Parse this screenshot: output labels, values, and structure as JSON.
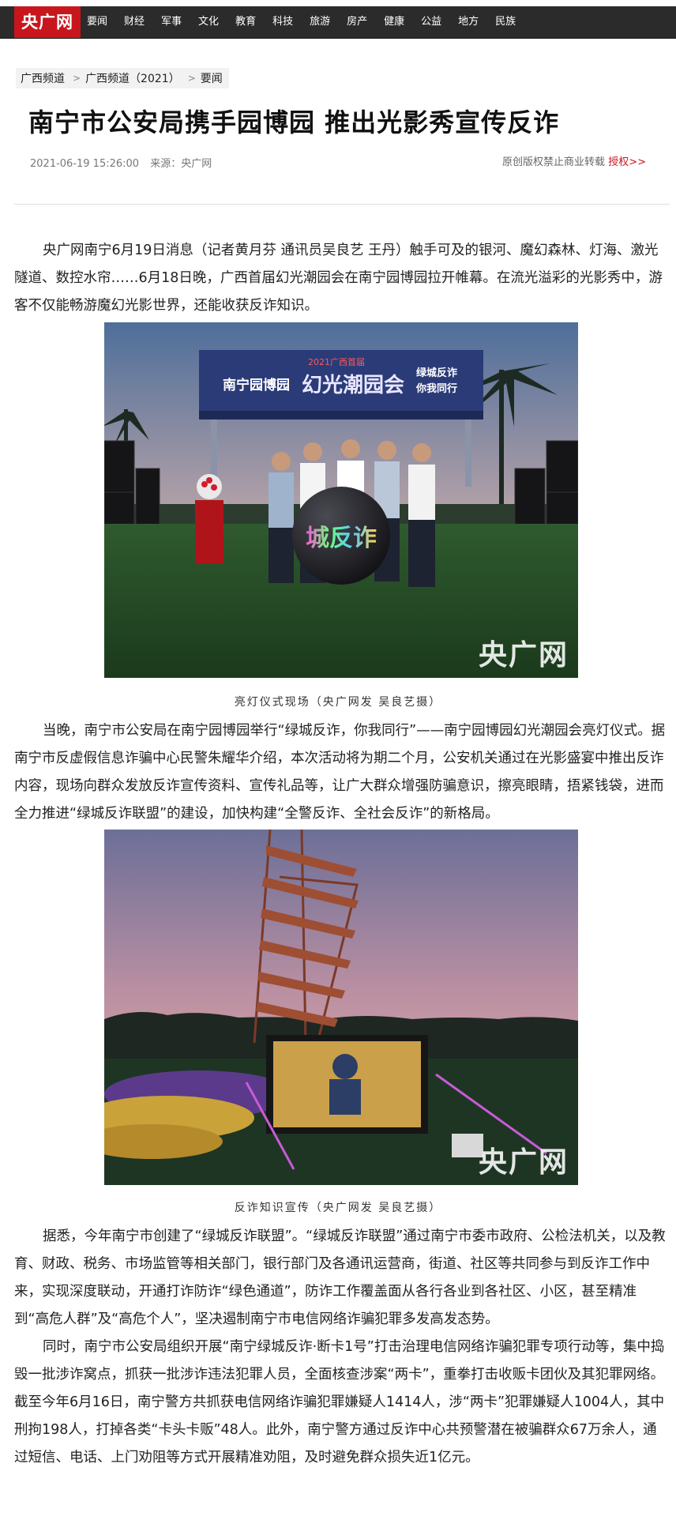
{
  "site": {
    "logo": "央广网",
    "nav": [
      "要闻",
      "财经",
      "军事",
      "文化",
      "教育",
      "科技",
      "旅游",
      "房产",
      "健康",
      "公益",
      "地方",
      "民族"
    ]
  },
  "breadcrumb": {
    "items": [
      "广西频道",
      "广西频道（2021）",
      "要闻"
    ],
    "separator": ">"
  },
  "article": {
    "title": "南宁市公安局携手园博园 推出光影秀宣传反诈",
    "date": "2021-06-19 15:26:00",
    "source": "来源：央广网",
    "copyright_text": "原创版权禁止商业转载",
    "copyright_link": "授权>>",
    "paragraphs": [
      "央广网南宁6月19日消息（记者黄月芬 通讯员吴良艺 王丹）触手可及的银河、魔幻森林、灯海、激光隧道、数控水帘……6月18日晚，广西首届幻光潮园会在南宁园博园拉开帷幕。在流光溢彩的光影秀中，游客不仅能畅游魔幻光影世界，还能收获反诈知识。",
      "当晚，南宁市公安局在南宁园博园举行“绿城反诈，你我同行”——南宁园博园幻光潮园会亮灯仪式。据南宁市反虚假信息诈骗中心民警朱耀华介绍，本次活动将为期二个月，公安机关通过在光影盛宴中推出反诈内容，现场向群众发放反诈宣传资料、宣传礼品等，让广大群众增强防骗意识，擦亮眼睛，捂紧钱袋，进而全力推进“绿城反诈联盟”的建设，加快构建“全警反诈、全社会反诈”的新格局。",
      "据悉，今年南宁市创建了“绿城反诈联盟”。“绿城反诈联盟”通过南宁市委市政府、公检法机关，以及教育、财政、税务、市场监管等相关部门，银行部门及各通讯运营商，街道、社区等共同参与到反诈工作中来，实现深度联动，开通打诈防诈“绿色通道”，防诈工作覆盖面从各行各业到各社区、小区，甚至精准到“高危人群”及“高危个人”，坚决遏制南宁市电信网络诈骗犯罪多发高发态势。",
      "同时，南宁市公安局组织开展“南宁绿城反诈·断卡1号”打击治理电信网络诈骗犯罪专项行动等，集中捣毁一批涉诈窝点，抓获一批涉诈违法犯罪人员，全面核查涉案“两卡”，重拳打击收贩卡团伙及其犯罪网络。截至今年6月16日，南宁警方共抓获电信网络诈骗犯罪嫌疑人1414人，涉“两卡”犯罪嫌疑人1004人，其中刑拘198人，打掉各类“卡头卡贩”48人。此外，南宁警方通过反诈中心共预警潜在被骗群众67万余人，通过短信、电话、上门劝阻等方式开展精准劝阻，及时避免群众损失近1亿元。"
    ],
    "photos": [
      {
        "caption": "亮灯仪式现场（央广网发 吴良艺摄）",
        "watermark": "央广网",
        "banner_venue": "南宁园博园",
        "banner_event": "幻光潮园会",
        "banner_year": "2021广西首届",
        "banner_slogan_1": "绿城反诈",
        "banner_slogan_2": "你我同行",
        "sphere_text": "城反诈"
      },
      {
        "caption": "反诈知识宣传（央广网发 吴良艺摄）",
        "watermark": "央广网"
      }
    ]
  }
}
